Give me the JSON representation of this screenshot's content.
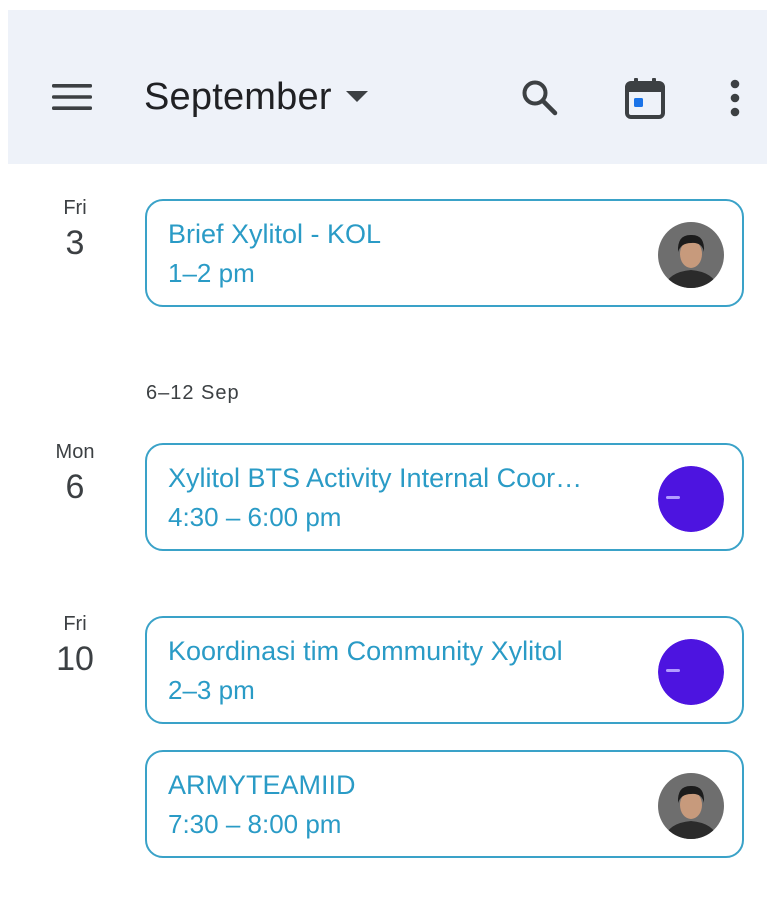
{
  "header": {
    "month": "September",
    "icons": {
      "menu": "hamburger-menu-icon",
      "dropdown": "caret-down-icon",
      "search": "search-icon",
      "today": "calendar-today-icon",
      "more": "more-vertical-icon"
    },
    "background": "#eef2f9"
  },
  "agenda": {
    "accent_color": "#2a9bc6",
    "border_color": "#3aa2c8",
    "days": [
      {
        "dow": "Fri",
        "dom": "3",
        "events": [
          {
            "title": "Brief Xylitol - KOL",
            "time": "1–2 pm",
            "avatar": "person-photo-avatar"
          }
        ]
      },
      {
        "dow": "Mon",
        "dom": "6",
        "events": [
          {
            "title": "Xylitol BTS Activity Internal Coor…",
            "time": "4:30 – 6:00 pm",
            "avatar": "purple-logo-avatar"
          }
        ]
      },
      {
        "dow": "Fri",
        "dom": "10",
        "events": [
          {
            "title": "Koordinasi tim Community Xylitol",
            "time": "2–3 pm",
            "avatar": "purple-logo-avatar"
          },
          {
            "title": "ARMYTEAMIID",
            "time": "7:30 – 8:00 pm",
            "avatar": "person-photo-avatar"
          }
        ]
      }
    ],
    "week_separator": "6–12 Sep"
  }
}
